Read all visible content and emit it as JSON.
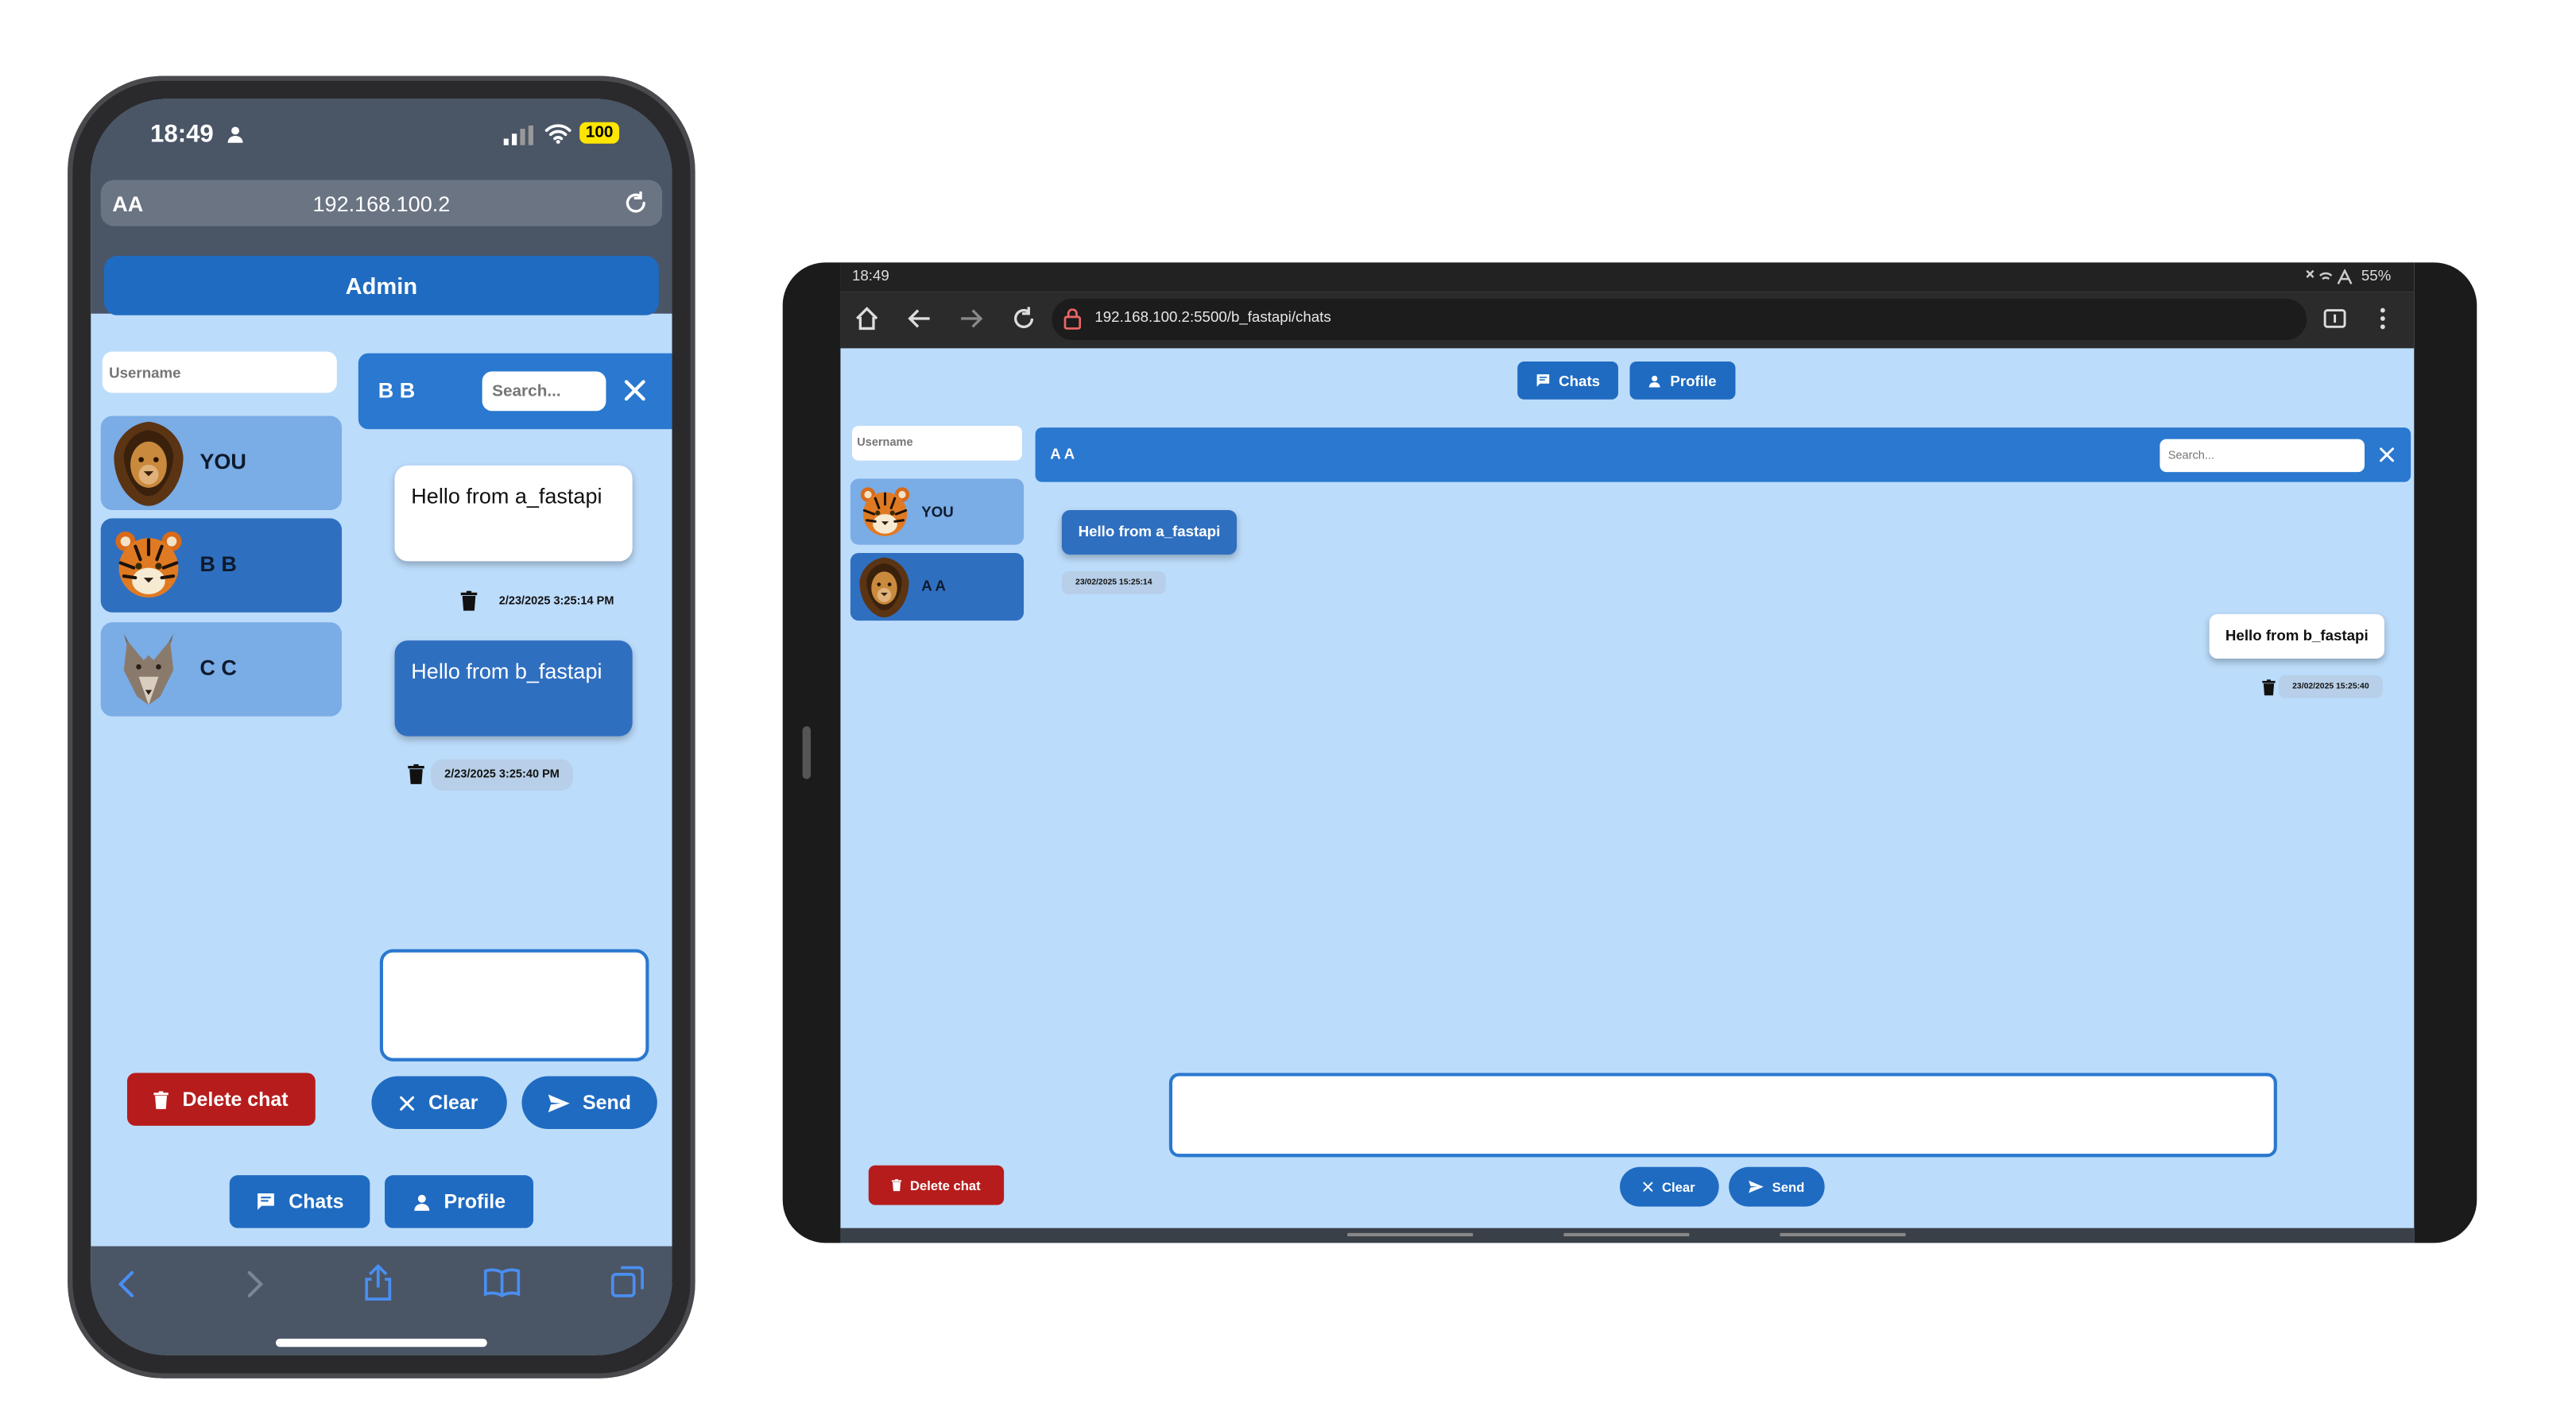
{
  "phone": {
    "status": {
      "time": "18:49",
      "battery": "100"
    },
    "address_bar": {
      "text_size": "AA",
      "url": "192.168.100.2"
    },
    "admin_label": "Admin",
    "username_placeholder": "Username",
    "contacts": [
      {
        "name": "YOU",
        "avatar": "lion-avatar",
        "selected": false
      },
      {
        "name": "B B",
        "avatar": "tiger-avatar",
        "selected": true
      },
      {
        "name": "C C",
        "avatar": "wolf-avatar",
        "selected": false
      }
    ],
    "chat_header": {
      "title": "B B",
      "search_placeholder": "Search..."
    },
    "messages": [
      {
        "text": "Hello from a_fastapi",
        "timestamp": "2/23/2025 3:25:14 PM",
        "style": "received"
      },
      {
        "text": "Hello from b_fastapi",
        "timestamp": "2/23/2025 3:25:40 PM",
        "style": "sent"
      }
    ],
    "buttons": {
      "delete_chat": "Delete chat",
      "clear": "Clear",
      "send": "Send"
    },
    "bottom_nav": {
      "chats": "Chats",
      "profile": "Profile"
    },
    "browser_toolbar_icons": [
      "back-icon",
      "forward-icon",
      "share-icon",
      "bookmarks-icon",
      "tabs-icon"
    ]
  },
  "tablet": {
    "status": {
      "time": "18:49",
      "battery": "55%"
    },
    "address_bar": {
      "url": "192.168.100.2:5500/b_fastapi/chats"
    },
    "top_nav": {
      "chats": "Chats",
      "profile": "Profile"
    },
    "username_placeholder": "Username",
    "contacts": [
      {
        "name": "YOU",
        "avatar": "tiger-avatar",
        "selected": false
      },
      {
        "name": "A A",
        "avatar": "lion-avatar",
        "selected": true
      }
    ],
    "chat_header": {
      "title": "A A",
      "search_placeholder": "Search..."
    },
    "messages": [
      {
        "text": "Hello from a_fastapi",
        "timestamp": "23/02/2025 15:25:14",
        "style": "received"
      },
      {
        "text": "Hello from b_fastapi",
        "timestamp": "23/02/2025 15:25:40",
        "style": "sent"
      }
    ],
    "buttons": {
      "delete_chat": "Delete chat",
      "clear": "Clear",
      "send": "Send"
    }
  },
  "colors": {
    "page_bg": "#bcdcfb",
    "primary": "#1f6bc1",
    "header_blue": "#2a78cf",
    "contact_light": "#7aace6",
    "contact_selected": "#2f6fc0",
    "danger": "#b71c1c",
    "phone_chrome": "#4a5566"
  }
}
